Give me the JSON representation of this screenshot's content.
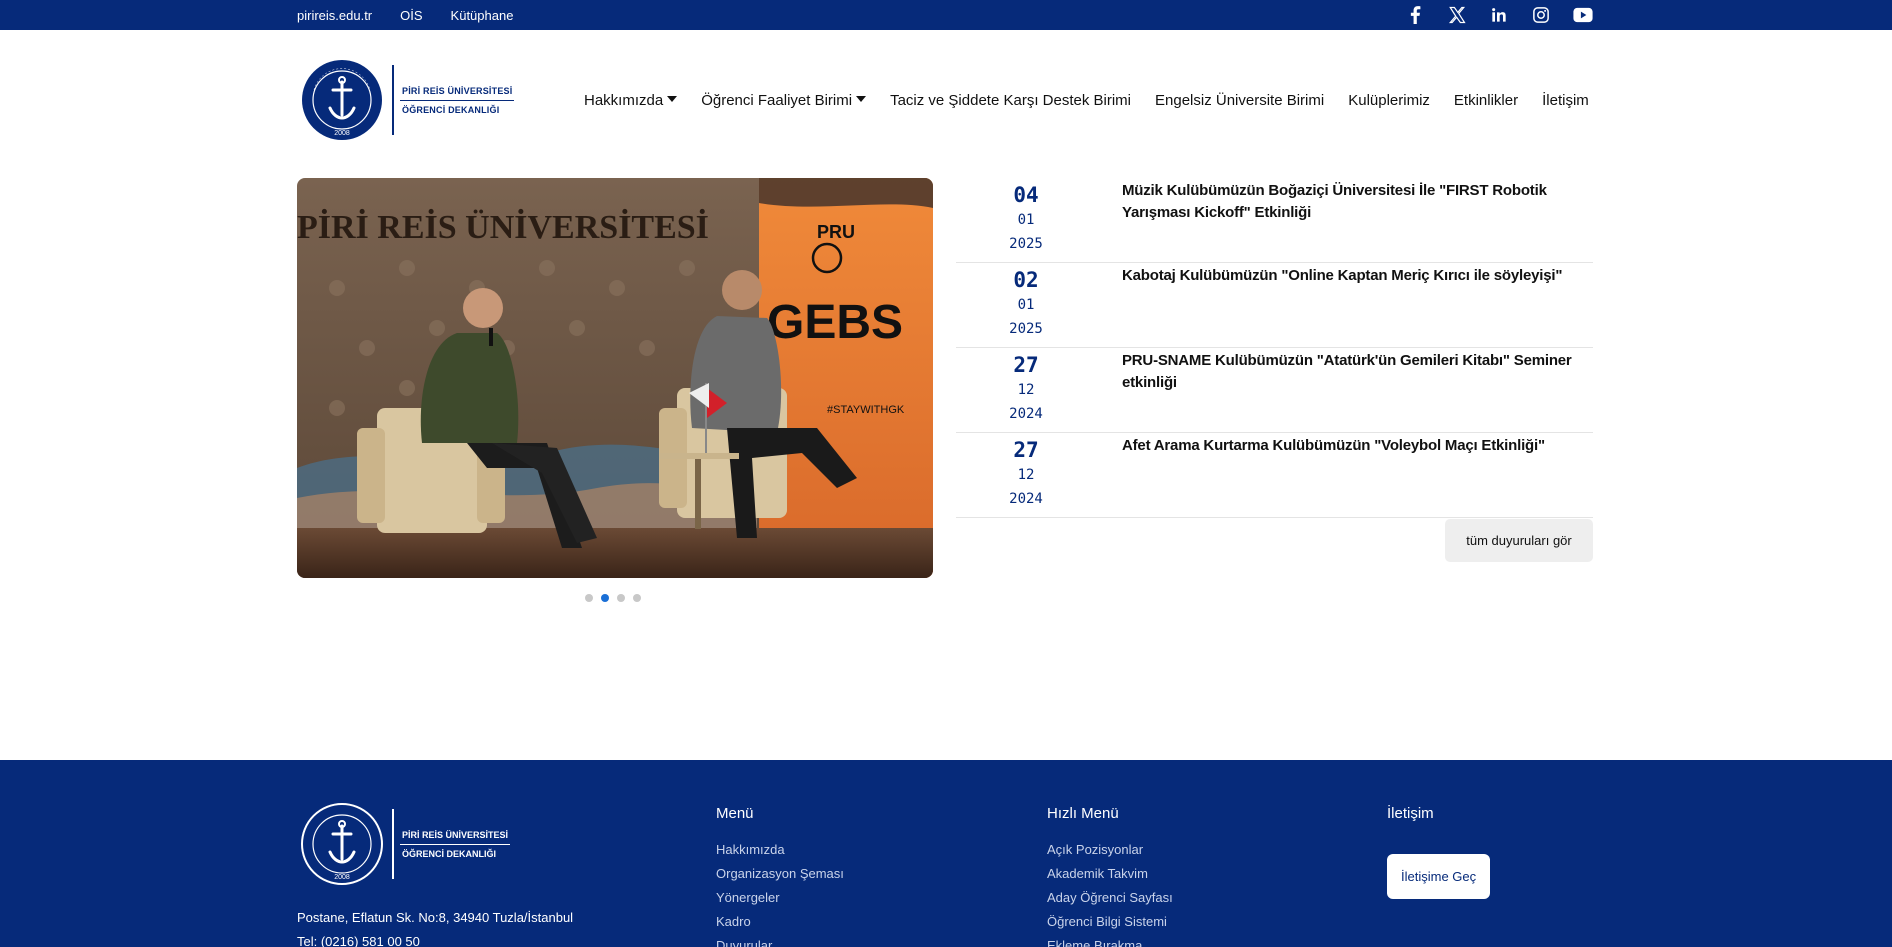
{
  "topbar": {
    "links": [
      "pirireis.edu.tr",
      "OİS",
      "Kütüphane"
    ],
    "social_icons": [
      "facebook-icon",
      "x-icon",
      "linkedin-icon",
      "instagram-icon",
      "youtube-icon"
    ]
  },
  "logo": {
    "line1": "PİRİ REİS ÜNİVERSİTESİ",
    "line2": "ÖĞRENCİ DEKANLIĞI",
    "seal_top": "PİRİ REİS ÜNİVERSİTESİ",
    "seal_year": "2008"
  },
  "nav": [
    {
      "label": "Hakkımızda",
      "dropdown": true
    },
    {
      "label": "Öğrenci Faaliyet Birimi",
      "dropdown": true
    },
    {
      "label": "Taciz ve Şiddete Karşı Destek Birimi",
      "dropdown": false
    },
    {
      "label": "Engelsiz Üniversite Birimi",
      "dropdown": false
    },
    {
      "label": "Kulüplerimiz",
      "dropdown": false
    },
    {
      "label": "Etkinlikler",
      "dropdown": false
    },
    {
      "label": "İletişim",
      "dropdown": false
    }
  ],
  "slider": {
    "banner_text": "PİRİ REİS ÜNİVERSİTESİ",
    "poster_brand": "PRU",
    "poster_title": "GEBS",
    "poster_tag": "#STAYWITHGK",
    "active_slide": 2,
    "slide_count": 4
  },
  "news": [
    {
      "day": "04",
      "month": "01",
      "year": "2025",
      "title": "Müzik Kulübümüzün Boğaziçi Üniversitesi İle \"FIRST Robotik Yarışması Kickoff\" Etkinliği"
    },
    {
      "day": "02",
      "month": "01",
      "year": "2025",
      "title": "Kabotaj Kulübümüzün \"Online Kaptan Meriç Kırıcı ile söyleyişi\""
    },
    {
      "day": "27",
      "month": "12",
      "year": "2024",
      "title": "PRU-SNAME Kulübümüzün \"Atatürk'ün Gemileri Kitabı\" Seminer etkinliği"
    },
    {
      "day": "27",
      "month": "12",
      "year": "2024",
      "title": "Afet Arama Kurtarma Kulübümüzün \"Voleybol Maçı Etkinliği\""
    }
  ],
  "all_news_label": "tüm duyuruları gör",
  "footer": {
    "address": "Postane, Eflatun Sk. No:8, 34940 Tuzla/İstanbul",
    "phone": "Tel: (0216) 581 00 50",
    "menu_title": "Menü",
    "menu_items": [
      "Hakkımızda",
      "Organizasyon Şeması",
      "Yönergeler",
      "Kadro",
      "Duyurular"
    ],
    "quick_title": "Hızlı Menü",
    "quick_items": [
      "Açık Pozisyonlar",
      "Akademik Takvim",
      "Aday Öğrenci Sayfası",
      "Öğrenci Bilgi Sistemi",
      "Ekleme Bırakma"
    ],
    "contact_title": "İletişim",
    "contact_button": "İletişime Geç"
  },
  "colors": {
    "primary": "#062a7a",
    "accent_dot": "#1a6fd6",
    "button_bg": "#eeeeee"
  }
}
